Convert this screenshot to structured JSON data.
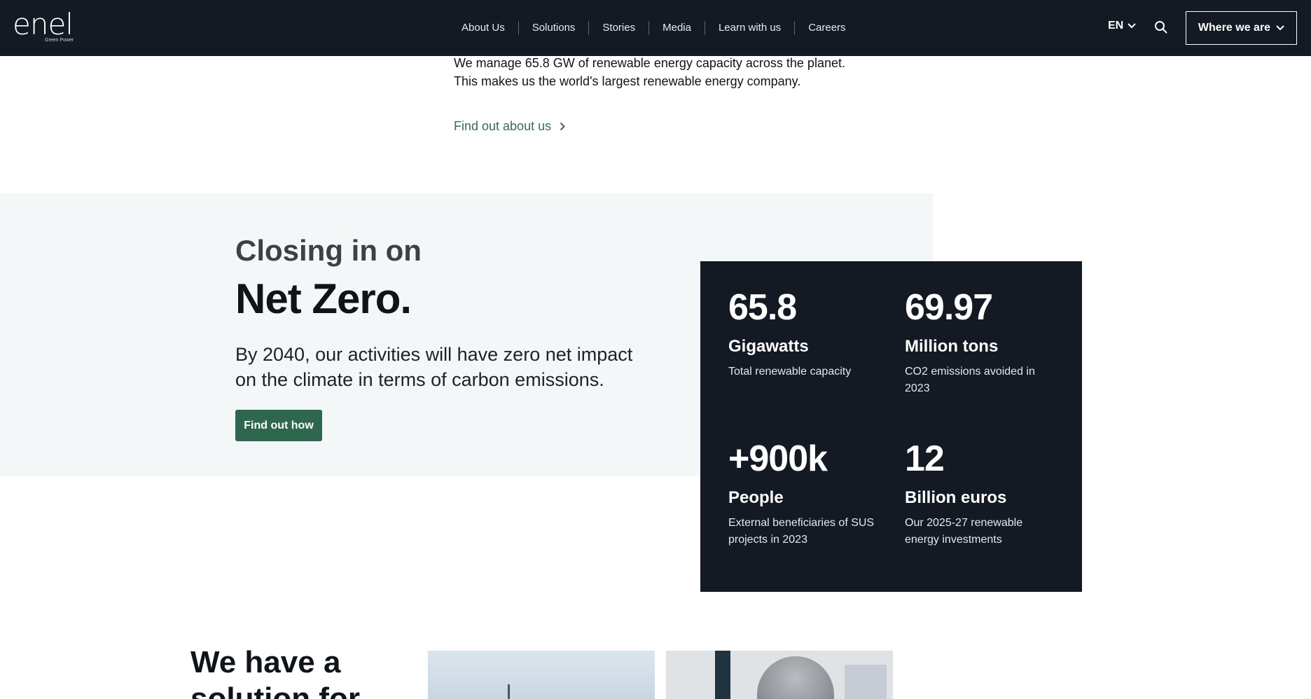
{
  "header": {
    "logo_text": "enel",
    "logo_sub": "Green Power",
    "nav": [
      "About Us",
      "Solutions",
      "Stories",
      "Media",
      "Learn with us",
      "Careers"
    ],
    "lang": "EN",
    "where_label": "Where we are"
  },
  "intro": {
    "line1": "We manage 65.8 GW of renewable energy capacity across the planet.",
    "line2": "This makes us the world's largest renewable energy company.",
    "link": "Find out about us"
  },
  "netzero": {
    "kicker": "Closing in on",
    "title": "Net Zero.",
    "text": "By 2040, our activities will have zero net impact on the climate in terms of carbon emissions.",
    "button": "Find out how"
  },
  "stats": [
    {
      "num": "65.8",
      "unit": "Gigawatts",
      "desc": "Total renewable capacity"
    },
    {
      "num": "69.97",
      "unit": "Million tons",
      "desc": "CO2 emissions avoided in 2023"
    },
    {
      "num": "+900k",
      "unit": "People",
      "desc": "External beneficiaries of SUS projects in 2023"
    },
    {
      "num": "12",
      "unit": "Billion euros",
      "desc": "Our 2025-27 renewable energy investments"
    }
  ],
  "bottom": {
    "title": "We have a solution for"
  },
  "colors": {
    "header_bg": "#131a23",
    "accent_green": "#2e6650",
    "link_green": "#3a6b55",
    "band_bg": "#f4f7f8"
  }
}
